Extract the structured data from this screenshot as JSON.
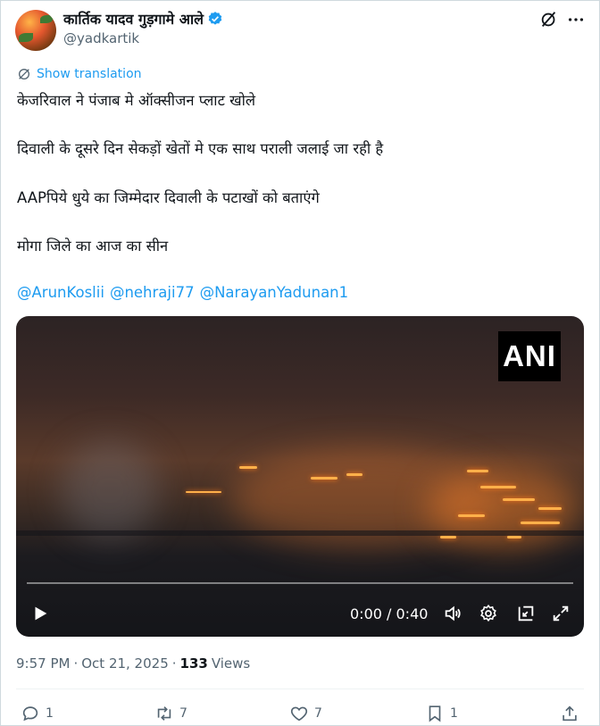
{
  "author": {
    "display_name": "कार्तिक यादव गुड़गामे आले",
    "handle": "@yadkartik"
  },
  "post": {
    "show_translation": "Show translation",
    "paragraphs": [
      "केजरिवाल ने पंजाब मे ऑक्सीजन प्लाट खोले",
      "दिवाली के दूसरे दिन सेकड़ों खेतों मे एक साथ पराली जलाई जा रही है",
      "AAPपिये  धुये का जिम्मेदार दिवाली के पटाखों को बताएंगे",
      "मोगा जिले का आज का सीन"
    ],
    "mentions": [
      "@ArunKoslii",
      "@nehraji77",
      "@NarayanYadunan1"
    ]
  },
  "video": {
    "watermark": "ANI",
    "time_display": "0:00 / 0:40",
    "progress": 0
  },
  "meta": {
    "time": "9:57 PM",
    "separator": "·",
    "date": "Oct 21, 2025",
    "views_count": "133",
    "views_label": "Views"
  },
  "actions": {
    "replies": "1",
    "reposts": "7",
    "likes": "7",
    "bookmarks": "1"
  },
  "colors": {
    "accent": "#1d9bf0",
    "secondary_text": "#536471",
    "primary_text": "#0f1419"
  }
}
